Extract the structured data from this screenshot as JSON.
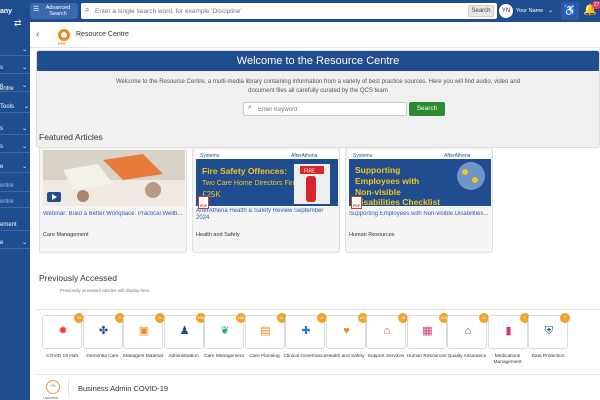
{
  "sidebar": {
    "brand": "any",
    "items": [
      {
        "label": "",
        "top": 0
      },
      {
        "label": "s"
      },
      {
        "label": "e"
      },
      {
        "label": "entre"
      },
      {
        "label": "Tools"
      },
      {
        "label": "s"
      },
      {
        "label": "s"
      },
      {
        "label": "e"
      },
      {
        "label": "entre"
      },
      {
        "label": "entre"
      },
      {
        "label": "ement"
      },
      {
        "label": "e"
      }
    ]
  },
  "topbar": {
    "advanced_search_label": "Advanced Search",
    "search_placeholder": "Enter a single search word, for example 'Discipline'",
    "search_button": "Search",
    "avatar_initials": "YN",
    "user_name": "Your Name",
    "notification_count": "27"
  },
  "breadcrumb": {
    "logo_text": "PDF",
    "title": "Resource Centre"
  },
  "welcome": {
    "heading": "Welcome to the Resource Centre",
    "description": "Welcome to the Resource Centre, a multi-media library containing information from a variety of best practice sources. Here you will find audio, video and document files all carefully curated by the QCS team",
    "keyword_placeholder": "Enter Keyword",
    "search_button": "Search"
  },
  "featured": {
    "title": "Featured Articles",
    "cards": [
      {
        "title": "Webinar: Build a Better Workplace: Practical Wellb...",
        "category": "Care Management",
        "thumb_text": "",
        "is_pdf": false
      },
      {
        "title": "AfterAthena Health & Safety Review September 2024",
        "category": "Health and Safety",
        "thumb_brand": "Systems",
        "thumb_tag": "AfterAthena",
        "thumb_heading": "Fire Safety Offences:",
        "thumb_sub": "Two Care Home Directors Fined",
        "thumb_amount": "£25K",
        "thumb_sign": "FIRE",
        "pdf_label": "PDF"
      },
      {
        "title": "Supporting Employees with Non-visible Disabilities...",
        "category": "Human Resources",
        "thumb_brand": "Systems",
        "thumb_tag": "AfterAthena",
        "thumb_heading": "Supporting Employees with Non-visible Disabilities Checklist",
        "pdf_label": "PDF"
      }
    ]
  },
  "previous": {
    "title": "Previously Accessed",
    "note": "Previously accessed articles will display here."
  },
  "categories": [
    {
      "label": "COVID 19 Hub",
      "count": "38",
      "icon": "virus-icon",
      "glyph": "✹",
      "color": "#e0433c"
    },
    {
      "label": "Dementia Care",
      "count": "3",
      "icon": "brain-icon",
      "glyph": "✤",
      "color": "#1f4d8f"
    },
    {
      "label": "Managers Material",
      "count": "1",
      "icon": "manager-icon",
      "glyph": "▣",
      "color": "#ef8a1c"
    },
    {
      "label": "Administration",
      "count": "135",
      "icon": "people-icon",
      "glyph": "♟",
      "color": "#1f4d8f"
    },
    {
      "label": "Care Management",
      "count": "168",
      "icon": "care-icon",
      "glyph": "❦",
      "color": "#2aa27a"
    },
    {
      "label": "Care Planning",
      "count": "41",
      "icon": "planning-icon",
      "glyph": "▤",
      "color": "#ef8a1c"
    },
    {
      "label": "Clinical Governance",
      "count": "6",
      "icon": "cross-icon",
      "glyph": "✚",
      "color": "#1e7fd6"
    },
    {
      "label": "Health and Safety",
      "count": "64",
      "icon": "heart-icon",
      "glyph": "♥",
      "color": "#ef8a1c"
    },
    {
      "label": "Support Services",
      "count": "16",
      "icon": "house-icon",
      "glyph": "⌂",
      "color": "#e24a2c"
    },
    {
      "label": "Human Resources",
      "count": "105",
      "icon": "clipboard-icon",
      "glyph": "▦",
      "color": "#c93a6a"
    },
    {
      "label": "Quality Assurance",
      "count": "12",
      "icon": "home-star-icon",
      "glyph": "⌂",
      "color": "#8a2a8a"
    },
    {
      "label": "Medications Management",
      "count": "5",
      "icon": "pill-icon",
      "glyph": "▮",
      "color": "#d23a6a"
    },
    {
      "label": "Data Protection",
      "count": "7",
      "icon": "shield-icon",
      "glyph": "⛨",
      "color": "#1f4d8f"
    }
  ],
  "covid_row": {
    "circle_text": "0%",
    "updates_label": "Updates",
    "title": "Business Admin COVID-19"
  }
}
